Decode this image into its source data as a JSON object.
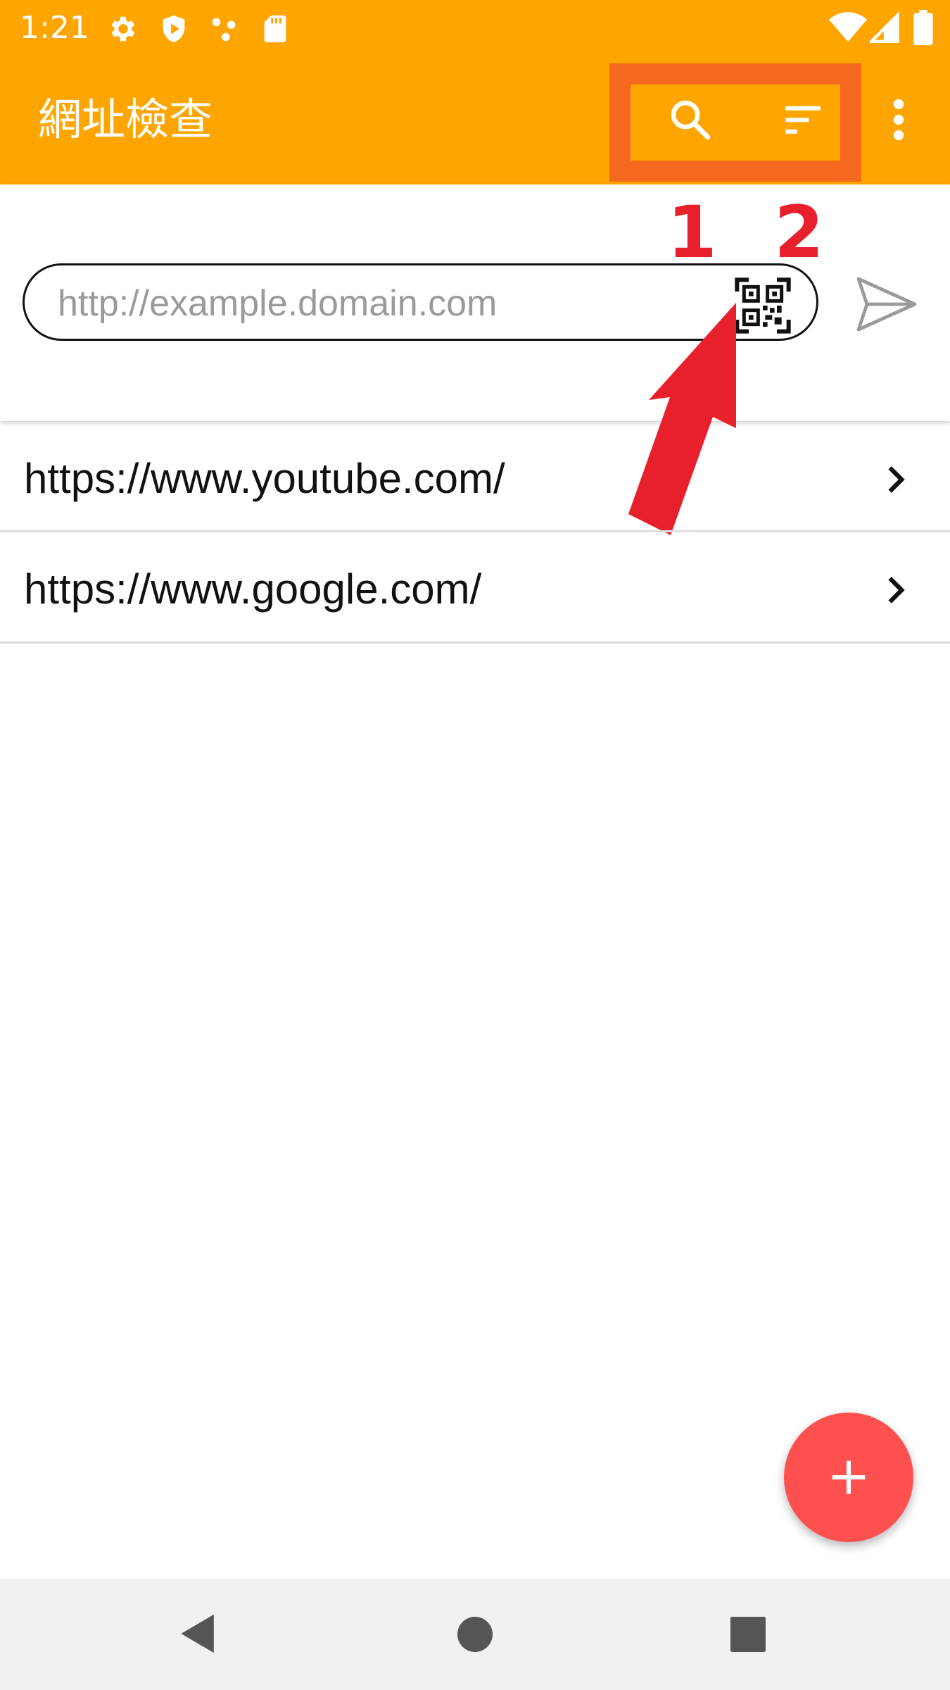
{
  "status_bar": {
    "time": "1:21",
    "icons": [
      "settings-icon",
      "shield-play-icon",
      "dots-icon",
      "sd-card-icon",
      "wifi-icon",
      "signal-icon",
      "battery-icon"
    ]
  },
  "app_bar": {
    "title": "網址檢查",
    "actions": [
      "search-icon",
      "sort-icon",
      "more-vert-icon"
    ],
    "highlight_color": "#F4691E",
    "background_color": "#FFA500"
  },
  "url_input": {
    "placeholder": "http://example.domain.com",
    "value": ""
  },
  "annotations": {
    "label_1": "1",
    "label_2": "2",
    "color": "#E8202C"
  },
  "history": [
    {
      "url": "https://www.youtube.com/"
    },
    {
      "url": "https://www.google.com/"
    }
  ],
  "fab": {
    "icon": "plus-icon",
    "color": "#FF5050"
  },
  "nav_bar": {
    "buttons": [
      "back-icon",
      "home-icon",
      "recents-icon"
    ]
  }
}
